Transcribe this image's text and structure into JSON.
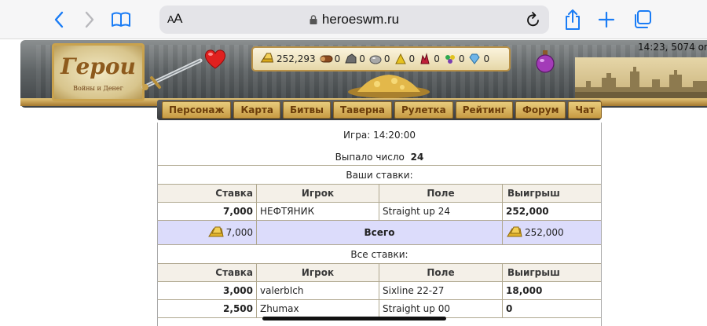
{
  "browser": {
    "aa_label": "AA",
    "url": "heroeswm.ru"
  },
  "game": {
    "logo_title": "Герои",
    "logo_subtitle": "Войны и Денег",
    "clock": "14:23, 5074 on",
    "resources": [
      {
        "name": "gold",
        "value": "252,293",
        "color": "#d9a91c"
      },
      {
        "name": "wood",
        "value": "0",
        "color": "#8b4a1f"
      },
      {
        "name": "ore",
        "value": "0",
        "color": "#6d6d6d"
      },
      {
        "name": "mercury",
        "value": "0",
        "color": "#a8a8a8"
      },
      {
        "name": "sulfur",
        "value": "0",
        "color": "#e6c21f"
      },
      {
        "name": "crystals",
        "value": "0",
        "color": "#c0203a"
      },
      {
        "name": "gems",
        "value": "0",
        "color": "#7a3fb0"
      },
      {
        "name": "diamond",
        "value": "0",
        "color": "#6fb5e8"
      }
    ],
    "menu": [
      "Персонаж",
      "Карта",
      "Битвы",
      "Таверна",
      "Рулетка",
      "Рейтинг",
      "Форум",
      "Чат"
    ]
  },
  "roulette": {
    "game_label": "Игра: 14:20:00",
    "result_label": "Выпало число",
    "result_number": "24",
    "your_bets_caption": "Ваши ставки:",
    "columns": [
      "Ставка",
      "Игрок",
      "Поле",
      "Выигрыш"
    ],
    "your_bets": [
      {
        "bet": "7,000",
        "player": "НЕФТЯНИК",
        "field": "Straight up 24",
        "win": "252,000"
      }
    ],
    "total": {
      "bet": "7,000",
      "label": "Всего",
      "win": "252,000"
    },
    "all_bets_caption": "Все ставки:",
    "all_bets": [
      {
        "bet": "3,000",
        "player": "valerbIch",
        "field": "Sixline 22-27",
        "win": "18,000"
      },
      {
        "bet": "2,500",
        "player": "Zhumax",
        "field": "Straight up 00",
        "win": "0"
      }
    ]
  }
}
